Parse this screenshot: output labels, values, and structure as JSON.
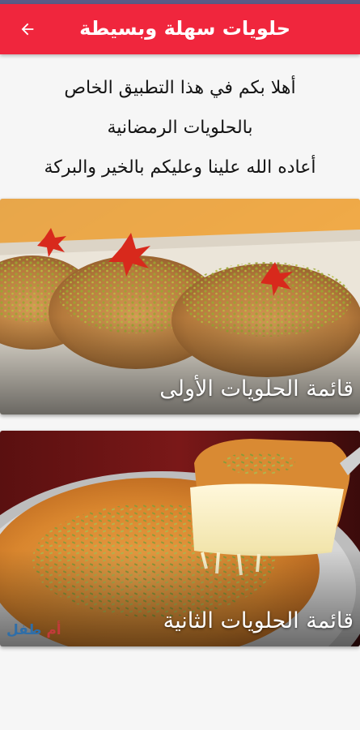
{
  "app_bar": {
    "title": "حلويات سهلة وبسيطة",
    "back_icon": "arrow-back-icon",
    "color": "#f0263d"
  },
  "welcome": {
    "line1": "أهلا بكم في هذا التطبيق الخاص",
    "line2": "بالحلويات الرمضانية",
    "line3": "أعاده الله علينا وعليكم بالخير والبركة"
  },
  "cards": [
    {
      "label": "قائمة الحلويات الأولى",
      "image": "qatayef-photo"
    },
    {
      "label": "قائمة الحلويات الثانية",
      "image": "kunafa-photo",
      "watermark_a": "أم",
      "watermark_b": "طفل"
    }
  ]
}
